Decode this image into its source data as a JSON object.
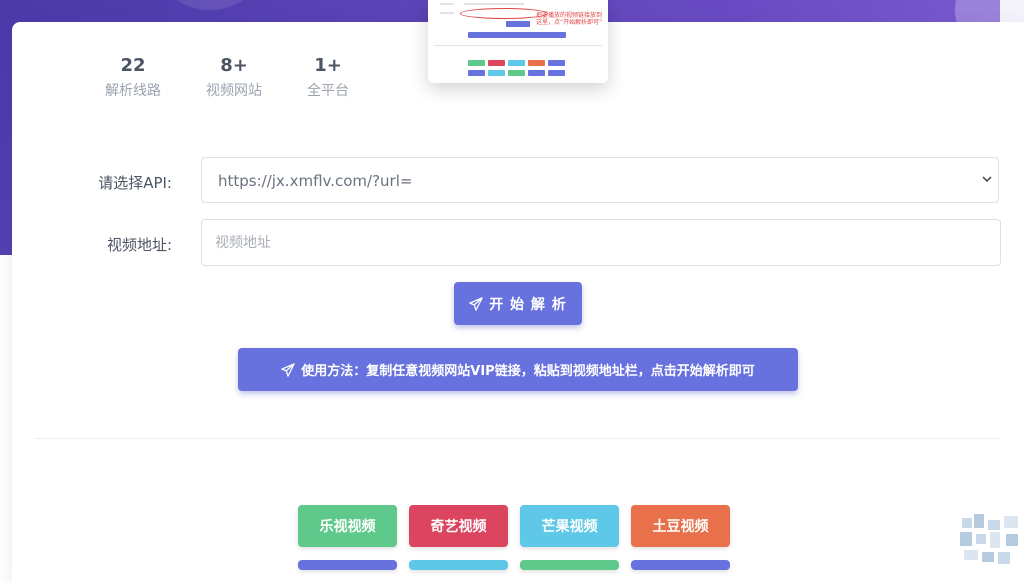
{
  "stats": [
    {
      "num": "22",
      "label": "解析线路"
    },
    {
      "num": "8+",
      "label": "视频网站"
    },
    {
      "num": "1+",
      "label": "全平台"
    }
  ],
  "preview": {
    "note": "把要播放的视频链接放到这里，点“开始解析即可”"
  },
  "form": {
    "api_label": "请选择API:",
    "api_value": "https://jx.xmflv.com/?url=",
    "url_label": "视频地址:",
    "url_placeholder": "视频地址"
  },
  "parse_button": "开 始 解 析",
  "howto_button": "使用方法：复制任意视频网站VIP链接，粘贴到视频地址栏，点击开始解析即可",
  "sites": [
    {
      "label": "乐视视频",
      "color": "#5ec98a"
    },
    {
      "label": "奇艺视频",
      "color": "#dc4560"
    },
    {
      "label": "芒果视频",
      "color": "#5fc8e8"
    },
    {
      "label": "土豆视频",
      "color": "#e8704a"
    }
  ],
  "colors": {
    "primary": "#6872df",
    "hero": "#5b44b8"
  }
}
